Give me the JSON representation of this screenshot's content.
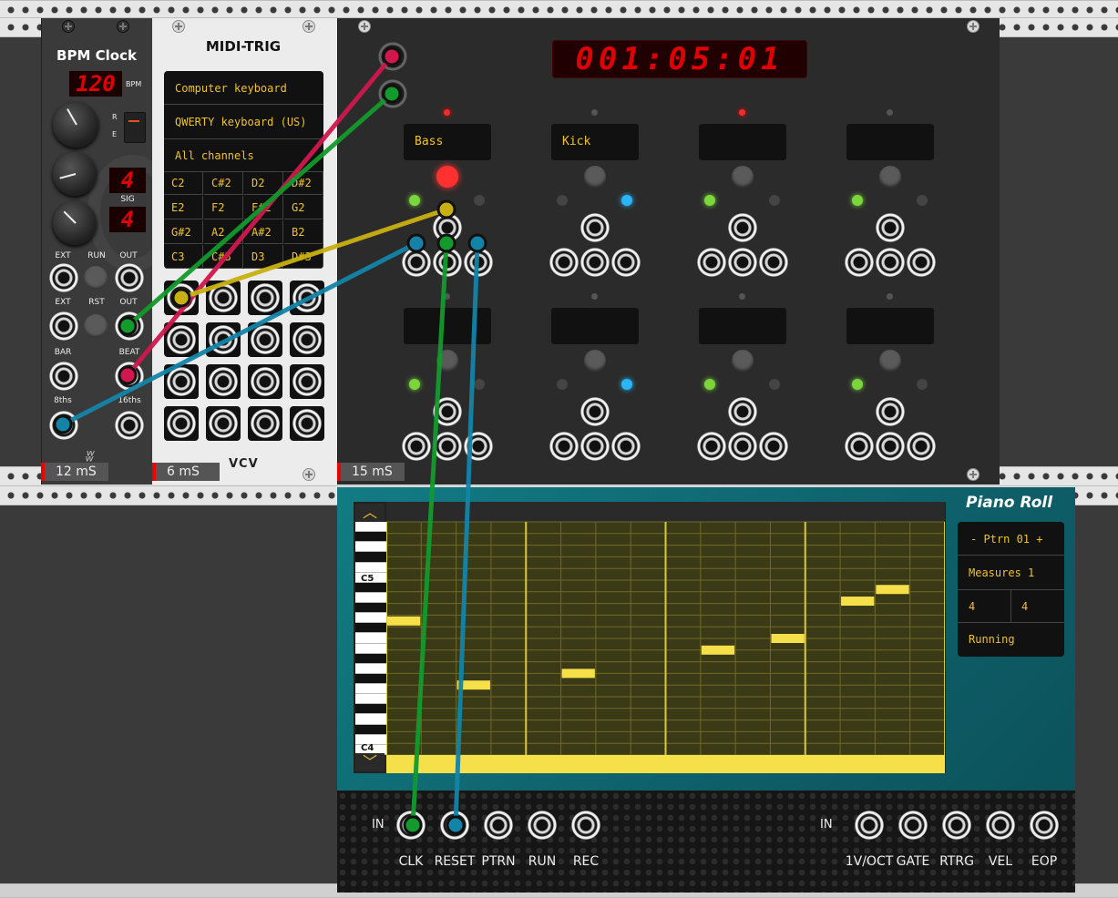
{
  "rack": {
    "status": {
      "bpm_clock": "12 mS",
      "midi_trig": "6 mS",
      "sequencer": "15 mS"
    }
  },
  "bpm_clock": {
    "title": "BPM Clock",
    "bpm_value": "120",
    "bpm_unit": "BPM",
    "run_switch_labels": {
      "r": "R",
      "e": "E"
    },
    "sig_top": "4",
    "sig_bottom": "4",
    "sig_label": "SIG",
    "row1": {
      "ext": "EXT",
      "run": "RUN",
      "out": "OUT"
    },
    "row2": {
      "ext": "EXT",
      "rst": "RST",
      "out": "OUT"
    },
    "bar": "BAR",
    "beat": "BEAT",
    "eighths": "8ths",
    "sixteenths": "16ths"
  },
  "midi_trig": {
    "title": "MIDI-TRIG",
    "driver": "Computer keyboard",
    "device": "QWERTY keyboard (US)",
    "channel": "All channels",
    "notes": [
      [
        "C2",
        "C#2",
        "D2",
        "D#2"
      ],
      [
        "E2",
        "F2",
        "F#2",
        "G2"
      ],
      [
        "G#2",
        "A2",
        "A#2",
        "B2"
      ],
      [
        "C3",
        "C#3",
        "D3",
        "D#3"
      ]
    ],
    "brand": "VCV"
  },
  "sequencer": {
    "clock": "001:05:01",
    "tracks": [
      "Bass",
      "Kick",
      "",
      "",
      "",
      "",
      "",
      ""
    ]
  },
  "piano_roll": {
    "title": "Piano Roll",
    "pattern": "- Ptrn 01 +",
    "measures": "Measures 1",
    "time_num": "4",
    "time_den": "4",
    "state": "Running",
    "key_c5": "C5",
    "key_c4": "C4",
    "in_label_1": "IN",
    "in_label_2": "IN",
    "inputs": [
      "CLK",
      "RESET",
      "PTRN",
      "RUN",
      "REC"
    ],
    "outputs": [
      "1V/OCT",
      "GATE",
      "RTRG",
      "VEL",
      "EOP"
    ],
    "notes": [
      {
        "step": 1,
        "pitch": "C5"
      },
      {
        "step": 3,
        "pitch": "F#4"
      },
      {
        "step": 6,
        "pitch": "G4"
      },
      {
        "step": 10,
        "pitch": "A4"
      },
      {
        "step": 12,
        "pitch": "A#4"
      },
      {
        "step": 14,
        "pitch": "C#5"
      },
      {
        "step": 15,
        "pitch": "D#5"
      }
    ]
  },
  "colors": {
    "red": "#d0184e",
    "green": "#139a2c",
    "yellow": "#c8b012",
    "blue": "#1384a8",
    "teal": "#0f6f7a",
    "amber": "#f0c22e"
  }
}
